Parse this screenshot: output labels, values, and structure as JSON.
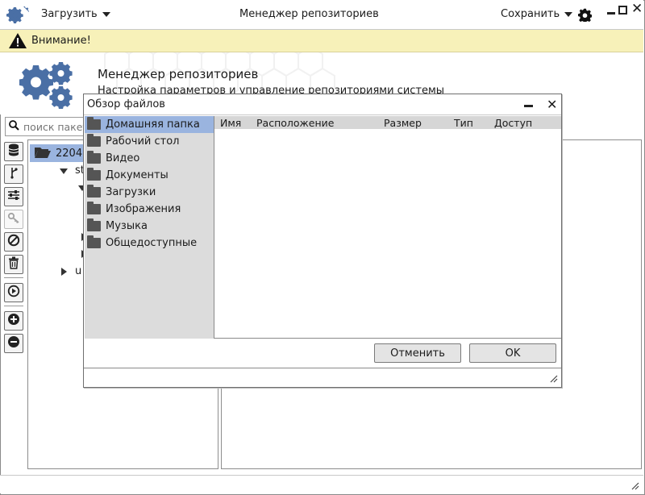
{
  "titlebar": {
    "load_label": "Загрузить",
    "title": "Менеджер репозиториев",
    "save_label": "Сохранить"
  },
  "warning": {
    "text": "Внимание!"
  },
  "header": {
    "title": "Менеджер репозиториев",
    "subtitle": "Настройка параметров и управление репозиториями системы"
  },
  "search": {
    "placeholder": "поиск пакетов"
  },
  "tree": {
    "root_label": "2204",
    "child1_label": "st",
    "child2_label": "u"
  },
  "dialog": {
    "title": "Обзор файлов",
    "places": [
      "Домашняя папка",
      "Рабочий стол",
      "Видео",
      "Документы",
      "Загрузки",
      "Изображения",
      "Музыка",
      "Общедоступные"
    ],
    "columns": [
      "Имя",
      "Расположение",
      "Размер",
      "Тип",
      "Доступ"
    ],
    "cancel_label": "Отменить",
    "ok_label": "OK"
  },
  "colors": {
    "accent_blue": "#4a6fa5",
    "selection": "#9ab4df",
    "warning_bg": "#f7f1b9"
  }
}
